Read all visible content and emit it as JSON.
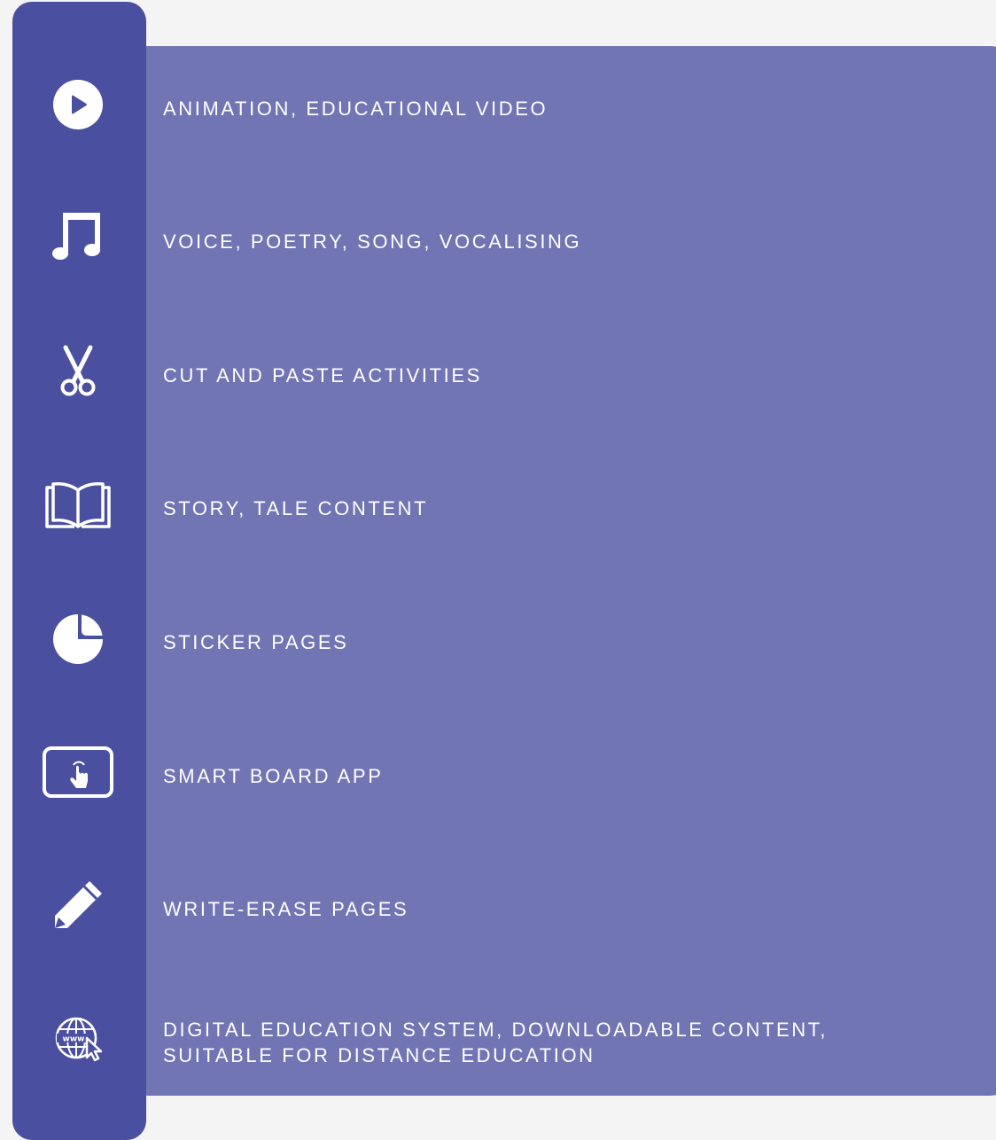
{
  "features": [
    {
      "icon": "play-icon",
      "label": "ANIMATION, EDUCATIONAL VIDEO"
    },
    {
      "icon": "music-note-icon",
      "label": "VOICE, POETRY, SONG, VOCALISING"
    },
    {
      "icon": "scissors-icon",
      "label": "CUT AND PASTE ACTIVITIES"
    },
    {
      "icon": "open-book-icon",
      "label": "STORY, TALE CONTENT"
    },
    {
      "icon": "sticker-icon",
      "label": "STICKER PAGES"
    },
    {
      "icon": "smart-board-touch-icon",
      "label": "SMART BOARD APP"
    },
    {
      "icon": "pencil-icon",
      "label": "WRITE-ERASE PAGES"
    },
    {
      "icon": "globe-www-cursor-icon",
      "label_lines": [
        "DIGITAL EDUCATION SYSTEM, DOWNLOADABLE CONTENT,",
        "SUITABLE FOR DISTANCE EDUCATION"
      ]
    }
  ],
  "colors": {
    "background": "#f4f4f5",
    "sidebar": "#4a509f",
    "panel": "#7175b4",
    "text": "#ffffff"
  }
}
